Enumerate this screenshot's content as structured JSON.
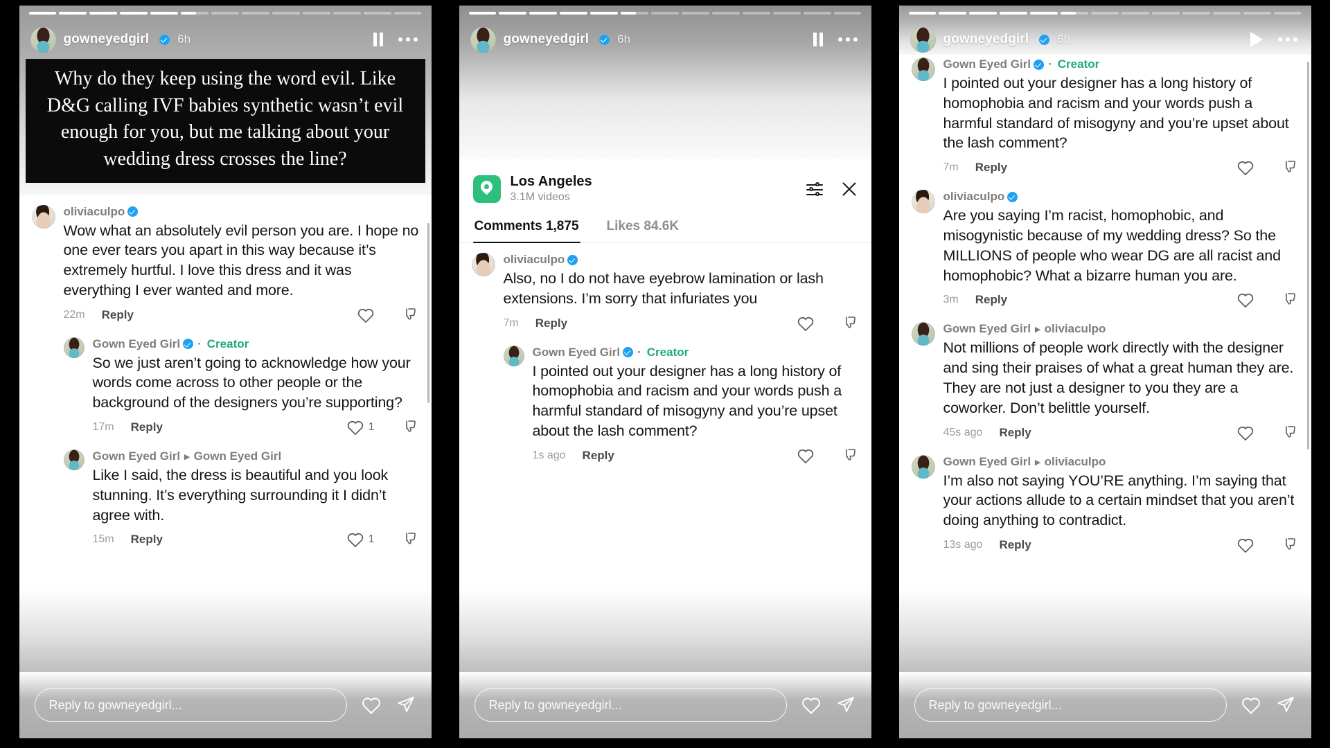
{
  "app": "instagram-story-comments",
  "story": {
    "username": "gowneyedgirl",
    "timestamp": "6h",
    "segments_total": 13,
    "segment_active_index": 5,
    "segment_active_progress": 55,
    "reply_placeholder": "Reply to gowneyedgirl..."
  },
  "panel1": {
    "sticker_text": "Why do they keep using the word evil. Like D&G calling IVF babies synthetic wasn’t evil enough for you, but me talking about your wedding dress crosses the line?",
    "header_right_icons": [
      "pause-icon",
      "more-options-icon"
    ],
    "comments": [
      {
        "author": "oliviaculpo",
        "verified": true,
        "creator": false,
        "reply_to": "",
        "text": "Wow what an absolutely evil person you are. I hope no one ever tears you apart in this way because it’s extremely hurtful. I love this dress and it was everything I ever wanted and more.",
        "time": "22m",
        "reply_label": "Reply",
        "likes": "",
        "indent": 0
      },
      {
        "author": "Gown Eyed Girl",
        "verified": true,
        "creator": true,
        "creator_label": "Creator",
        "reply_to": "",
        "text": "So we just aren’t going to acknowledge how your words come across to other people or the background of the designers you’re supporting?",
        "time": "17m",
        "reply_label": "Reply",
        "likes": "1",
        "indent": 1
      },
      {
        "author": "Gown Eyed Girl",
        "verified": false,
        "creator": false,
        "reply_to": "Gown Eyed Girl",
        "text": "Like I said, the dress is beautiful and you look stunning. It’s everything surrounding it I didn’t agree with.",
        "time": "15m",
        "reply_label": "Reply",
        "likes": "1",
        "indent": 1
      }
    ]
  },
  "panel2": {
    "header_right_icons": [
      "pause-icon",
      "more-options-icon"
    ],
    "location": {
      "name": "Los Angeles",
      "videos": "3.1M videos",
      "pin_color": "#2dc07d"
    },
    "sheet_actions": [
      "filter-icon",
      "close-icon"
    ],
    "tabs": [
      {
        "label": "Comments 1,875",
        "active": true
      },
      {
        "label": "Likes 84.6K",
        "active": false
      }
    ],
    "comments": [
      {
        "author": "oliviaculpo",
        "verified": true,
        "creator": false,
        "reply_to": "",
        "text": "Also, no I do not have eyebrow lamination or lash extensions. I’m sorry that infuriates you",
        "time": "7m",
        "reply_label": "Reply",
        "likes": "",
        "indent": 0
      },
      {
        "author": "Gown Eyed Girl",
        "verified": true,
        "creator": true,
        "creator_label": "Creator",
        "reply_to": "",
        "text": "I pointed out your designer has a long history of homophobia and racism and your words push a harmful standard of misogyny and you’re upset about the lash comment?",
        "time": "1s ago",
        "reply_label": "Reply",
        "likes": "",
        "indent": 1
      }
    ]
  },
  "panel3": {
    "header_right_icons": [
      "play-icon",
      "more-options-icon"
    ],
    "comments": [
      {
        "author": "Gown Eyed Girl",
        "verified": true,
        "creator": true,
        "creator_label": "Creator",
        "reply_to": "",
        "text": "I pointed out your designer has a long history of homophobia and racism and your words push a harmful standard of misogyny and you’re upset about the lash comment?",
        "time": "7m",
        "reply_label": "Reply",
        "likes": "",
        "indent": 0
      },
      {
        "author": "oliviaculpo",
        "verified": true,
        "creator": false,
        "reply_to": "",
        "text": "Are you saying I’m racist, homophobic, and misogynistic because of my wedding dress? So the MILLIONS of people who wear DG are all racist and homophobic? What a bizarre human you are.",
        "time": "3m",
        "reply_label": "Reply",
        "likes": "",
        "indent": 0
      },
      {
        "author": "Gown Eyed Girl",
        "verified": false,
        "creator": false,
        "reply_to": "oliviaculpo",
        "text": "Not millions of people work directly with the designer and sing their praises of what a great human they are. They are not just a designer to you they are a coworker. Don’t belittle yourself.",
        "time": "45s ago",
        "reply_label": "Reply",
        "likes": "",
        "indent": 0
      },
      {
        "author": "Gown Eyed Girl",
        "verified": false,
        "creator": false,
        "reply_to": "oliviaculpo",
        "text": "I’m also not saying YOU’RE anything. I’m saying that your actions allude to a certain mindset that you aren’t doing anything to contradict.",
        "time": "13s ago",
        "reply_label": "Reply",
        "likes": "",
        "indent": 0
      }
    ]
  },
  "colors": {
    "verified_blue": "#1da1f2",
    "creator_green": "#1ea97c",
    "pin_green": "#2dc07d",
    "background": "#000000"
  }
}
